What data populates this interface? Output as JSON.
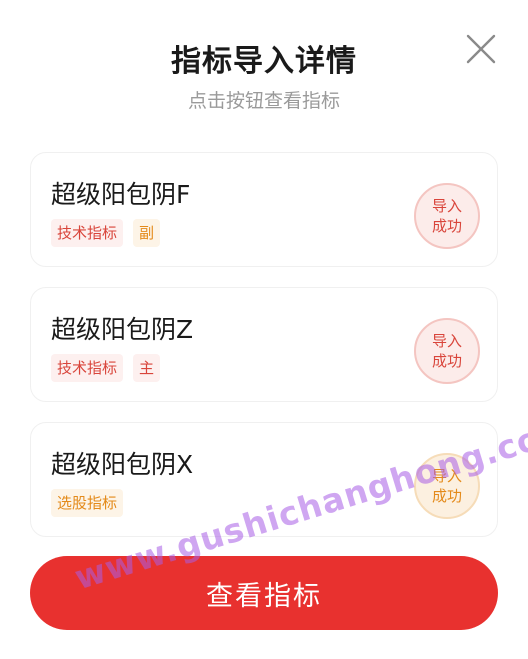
{
  "dialog": {
    "title": "指标导入详情",
    "subtitle": "点击按钮查看指标",
    "close_icon": "close-icon"
  },
  "cards": [
    {
      "name": "超级阳包阴F",
      "tags": [
        {
          "label": "技术指标",
          "color": "#d9453b"
        },
        {
          "label": "副",
          "color": "#e48a1a"
        }
      ],
      "status": {
        "line1": "导入",
        "line2": "成功",
        "color": "#d9453b"
      }
    },
    {
      "name": "超级阳包阴Z",
      "tags": [
        {
          "label": "技术指标",
          "color": "#d9453b"
        },
        {
          "label": "主",
          "color": "#d9453b"
        }
      ],
      "status": {
        "line1": "导入",
        "line2": "成功",
        "color": "#d9453b"
      }
    },
    {
      "name": "超级阳包阴X",
      "tags": [
        {
          "label": "选股指标",
          "color": "#e48a1a"
        }
      ],
      "status": {
        "line1": "导入",
        "line2": "成功",
        "color": "#e48a1a"
      }
    }
  ],
  "primary_button": {
    "label": "查看指标",
    "color": "#e8312f"
  },
  "watermark": "www.gushichanghong.com"
}
